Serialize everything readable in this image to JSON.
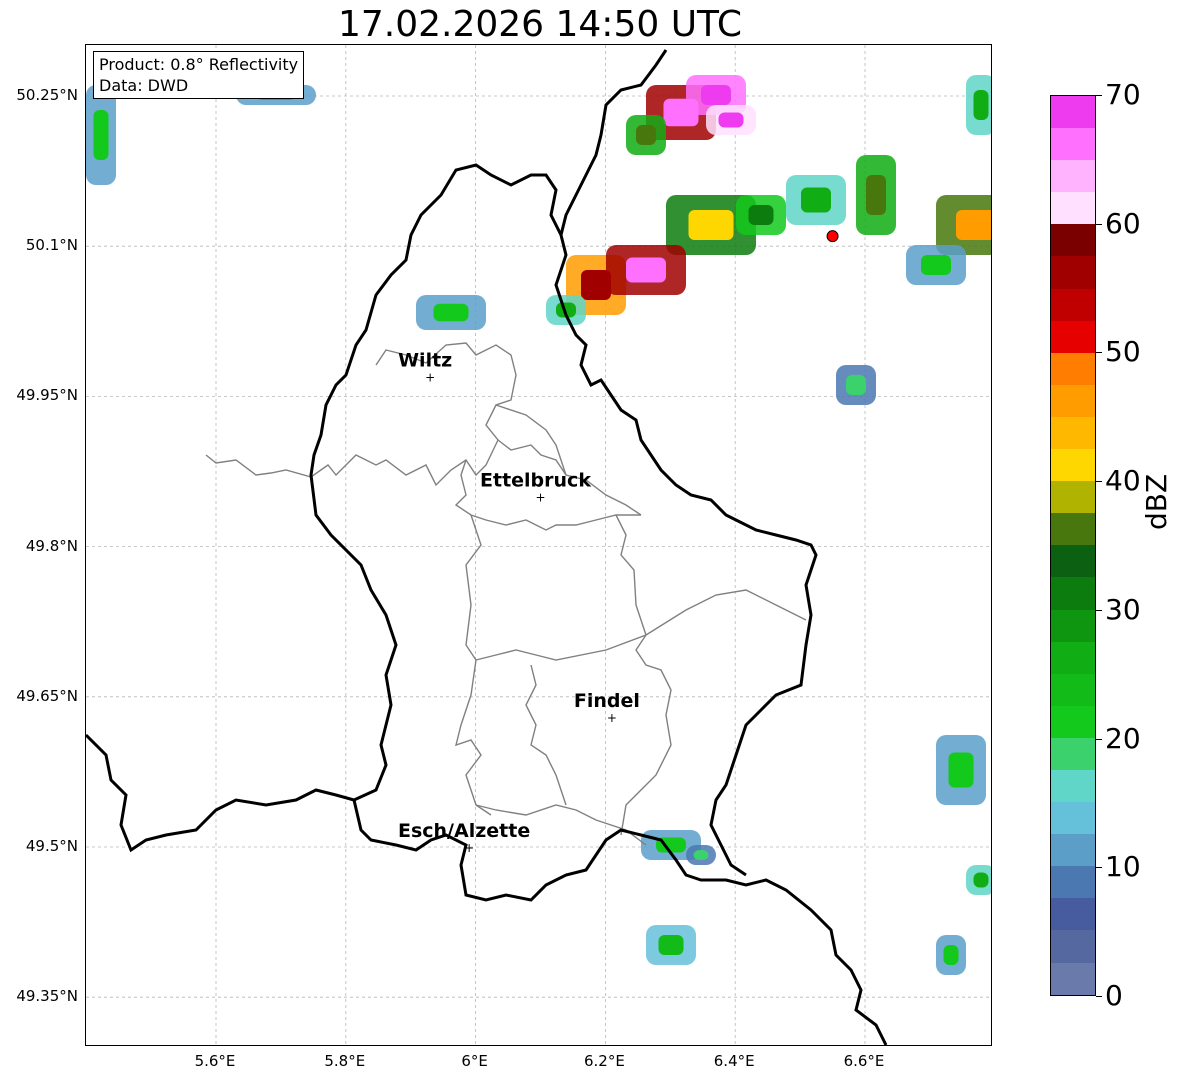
{
  "title": "17.02.2026 14:50 UTC",
  "info_box": {
    "product": "Product: 0.8° Reflectivity",
    "data_source": "Data: DWD"
  },
  "map": {
    "lon_range": [
      5.4,
      6.8
    ],
    "lat_range": [
      49.3,
      50.3
    ],
    "lat_ticks": [
      "50.25°N",
      "50.1°N",
      "49.95°N",
      "49.8°N",
      "49.65°N",
      "49.5°N",
      "49.35°N"
    ],
    "lon_ticks": [
      "5.6°E",
      "5.8°E",
      "6°E",
      "6.2°E",
      "6.4°E",
      "6.6°E"
    ],
    "cities": [
      {
        "name": "Wiltz",
        "lon": 5.93,
        "lat": 49.97
      },
      {
        "name": "Ettelbruck",
        "lon": 6.1,
        "lat": 49.85
      },
      {
        "name": "Findel",
        "lon": 6.21,
        "lat": 49.63
      },
      {
        "name": "Esch/Alzette",
        "lon": 5.99,
        "lat": 49.5
      }
    ],
    "radar_site": {
      "lon": 6.55,
      "lat": 50.11,
      "color": "#ff0000"
    }
  },
  "colorbar": {
    "unit": "dBZ",
    "tick_labels": [
      "0",
      "10",
      "20",
      "30",
      "40",
      "50",
      "60",
      "70"
    ],
    "min": 0,
    "max": 70,
    "colors": [
      "#6a7bab",
      "#5668a0",
      "#475c9e",
      "#4b78b1",
      "#5b9fc9",
      "#65c0da",
      "#5fd6c7",
      "#3bd26e",
      "#13c91c",
      "#12bb17",
      "#10ad14",
      "#0f9611",
      "#0c7c0e",
      "#0b6111",
      "#48780d",
      "#b0b300",
      "#ffd700",
      "#ffb800",
      "#ff9c00",
      "#ff7d00",
      "#e60000",
      "#c00000",
      "#a10000",
      "#7a0000",
      "#ffe0ff",
      "#ffb3ff",
      "#ff70ff",
      "#ee3bef"
    ]
  }
}
